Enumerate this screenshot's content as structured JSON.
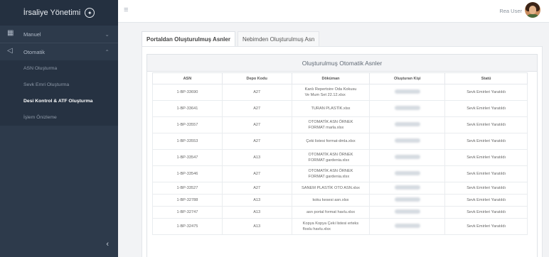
{
  "brand": {
    "title": "İrsaliye Yönetimi",
    "logo_icon": "seal-icon"
  },
  "sidebar": {
    "manuel_label": "Manuel",
    "otomatik_label": "Otomatik",
    "submenu": [
      "ASN Oluşturma",
      "Sevk Emri Oluşturma",
      "Desi Kontrol & ATF Oluşturma",
      "İşlem Önizleme"
    ],
    "active_index": 2
  },
  "header": {
    "user_name": "Rea User"
  },
  "tabs": [
    "Portaldan Oluşturulmuş Asnler",
    "Nebimden Oluşturulmuş Asn"
  ],
  "card": {
    "title": "Oluşturulmuş Otomatik Asnler"
  },
  "table": {
    "columns": [
      "ASN",
      "Depo Kodu",
      "Döküman",
      "Oluşturan Kişi",
      "Statü"
    ],
    "rows": [
      {
        "asn": "1-BP-33690",
        "depo": "A27",
        "doc1": "Kanlı Repertoire Oda Kokusu",
        "doc2": "Ve Mum Set 22.12.xlsx",
        "status": "Sevk Emirleri Yaratıldı",
        "size": "r"
      },
      {
        "asn": "1-BP-33641",
        "depo": "A27",
        "doc1": "TURAN PLASTİK.xlsx",
        "doc2": "",
        "status": "Sevk Emirleri Yaratıldı",
        "size": "r"
      },
      {
        "asn": "1-BP-33557",
        "depo": "A27",
        "doc1": "OTOMATİK ASN ÖRNEK",
        "doc2": "FORMAT marla.xlsx",
        "status": "Sevk Emirleri Yaratıldı",
        "size": "r"
      },
      {
        "asn": "1-BP-33553",
        "depo": "A27",
        "doc1": "Çeki listesi format-dmla.xlsx",
        "doc2": "",
        "status": "Sevk Emirleri Yaratıldı",
        "size": "r"
      },
      {
        "asn": "1-BP-33547",
        "depo": "A13",
        "doc1": "OTOMATİK ASN ÖRNEK",
        "doc2": "FORMAT gardenia.xlsx",
        "status": "Sevk Emirleri Yaratıldı",
        "size": "r"
      },
      {
        "asn": "1-BP-33546",
        "depo": "A27",
        "doc1": "OTOMATİK ASN ÖRNEK",
        "doc2": "FORMAT gardenia.xlsx",
        "status": "Sevk Emirleri Yaratıldı",
        "size": "r"
      },
      {
        "asn": "1-BP-33527",
        "depo": "A27",
        "doc1": "SANEM PLASTİK OTO ASN.xlsx",
        "doc2": "",
        "status": "Sevk Emirleri Yaratıldı",
        "size": "s"
      },
      {
        "asn": "1-BP-32788",
        "depo": "A13",
        "doc1": "koku kesesi asn.xlsx",
        "doc2": "",
        "status": "Sevk Emirleri Yaratıldı",
        "size": "s"
      },
      {
        "asn": "1-BP-32747",
        "depo": "A13",
        "doc1": "asn portal format havlu.xlsx",
        "doc2": "",
        "status": "Sevk Emirleri Yaratıldı",
        "size": "s"
      },
      {
        "asn": "1-BP-32475",
        "depo": "A13",
        "doc1": "Kopya Kopya Çeki listesi erteks",
        "doc2": "floslu havlu.xlsx",
        "status": "Sevk Emirleri Yaratıldı",
        "size": "r"
      }
    ]
  }
}
